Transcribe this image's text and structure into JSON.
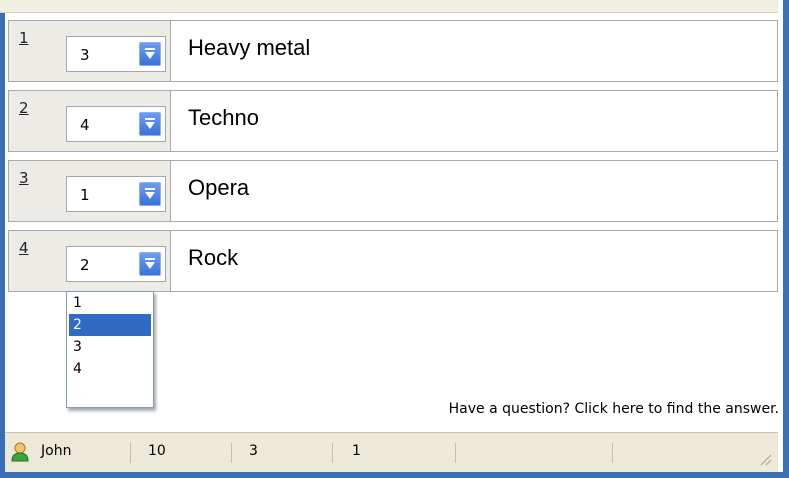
{
  "rows": [
    {
      "number": "1",
      "rank": "3",
      "genre": "Heavy metal"
    },
    {
      "number": "2",
      "rank": "4",
      "genre": "Techno"
    },
    {
      "number": "3",
      "rank": "1",
      "genre": "Opera"
    },
    {
      "number": "4",
      "rank": "2",
      "genre": "Rock"
    }
  ],
  "dropdown": {
    "options": [
      "1",
      "2",
      "3",
      "4"
    ],
    "selected": "2"
  },
  "help_link": "Have a question? Click here to find the answer.",
  "statusbar": {
    "user_icon": "user-icon",
    "user": "John",
    "field1": "10",
    "field2": "3",
    "field3": "1"
  },
  "colors": {
    "window_border": "#3b6fb5",
    "dropdown_button": "#3a72d9",
    "selection": "#316ac5"
  }
}
